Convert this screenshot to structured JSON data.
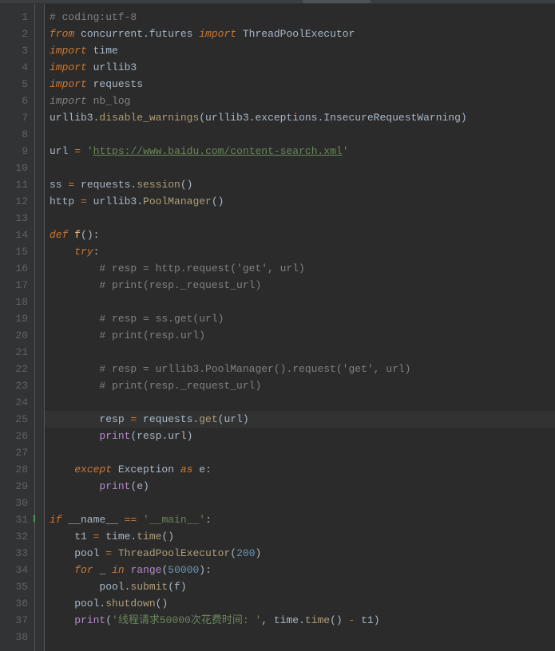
{
  "lines": {
    "l1_comment": "# coding:utf-8",
    "l2_from": "from",
    "l2_mod": " concurrent.futures ",
    "l2_imp": "import",
    "l2_name": " ThreadPoolExecutor",
    "l3_imp": "import",
    "l3_name": " time",
    "l4_imp": "import",
    "l4_name": " urllib3",
    "l5_imp": "import",
    "l5_name": " requests",
    "l6_imp": "import",
    "l6_name": " nb_log",
    "l7_a": "urllib3.",
    "l7_fn": "disable_warnings",
    "l7_b": "(urllib3.exceptions.InsecureRequestWarning)",
    "l9_a": "url ",
    "l9_eq": "=",
    "l9_b": " ",
    "l9_q1": "'",
    "l9_url": "https://www.baidu.com/content-search.xml",
    "l9_q2": "'",
    "l11_a": "ss ",
    "l11_eq": "=",
    "l11_b": " requests.",
    "l11_fn": "session",
    "l11_c": "()",
    "l12_a": "http ",
    "l12_eq": "=",
    "l12_b": " urllib3.",
    "l12_fn": "PoolManager",
    "l12_c": "()",
    "l14_def": "def ",
    "l14_fn": "f",
    "l14_b": "():",
    "l15_try": "try",
    "l15_c": ":",
    "l16": "        # resp = http.request('get', url)",
    "l17": "        # print(resp._request_url)",
    "l19": "        # resp = ss.get(url)",
    "l20": "        # print(resp.url)",
    "l22": "        # resp = urllib3.PoolManager().request('get', url)",
    "l23": "        # print(resp._request_url)",
    "l25_a": "        resp ",
    "l25_eq": "=",
    "l25_b": " requests.",
    "l25_fn": "get",
    "l25_c": "(url)",
    "l26_a": "        ",
    "l26_fn": "print",
    "l26_b": "(resp.url)",
    "l28_a": "    ",
    "l28_exc": "except ",
    "l28_b": "Exception ",
    "l28_as": "as ",
    "l28_c": "e:",
    "l29_a": "        ",
    "l29_fn": "print",
    "l29_b": "(e)",
    "l31_if": "if ",
    "l31_a": "__name__ ",
    "l31_eq": "==",
    "l31_b": " ",
    "l31_str": "'__main__'",
    "l31_c": ":",
    "l32_a": "    t1 ",
    "l32_eq": "=",
    "l32_b": " time.",
    "l32_fn": "time",
    "l32_c": "()",
    "l33_a": "    pool ",
    "l33_eq": "=",
    "l33_b": " ",
    "l33_fn": "ThreadPoolExecutor",
    "l33_c": "(",
    "l33_num": "200",
    "l33_d": ")",
    "l34_a": "    ",
    "l34_for": "for ",
    "l34_b": "_ ",
    "l34_in": "in ",
    "l34_fn": "range",
    "l34_c": "(",
    "l34_num": "50000",
    "l34_d": "):",
    "l35_a": "        pool.",
    "l35_fn": "submit",
    "l35_b": "(f)",
    "l36_a": "    pool.",
    "l36_fn": "shutdown",
    "l36_b": "()",
    "l37_a": "    ",
    "l37_fn": "print",
    "l37_b": "(",
    "l37_str": "'线程请求50000次花费时间: '",
    "l37_c": ", time.",
    "l37_fn2": "time",
    "l37_d": "() ",
    "l37_op": "-",
    "l37_e": " t1)"
  },
  "gutter": [
    "1",
    "2",
    "3",
    "4",
    "5",
    "6",
    "7",
    "8",
    "9",
    "10",
    "11",
    "12",
    "13",
    "14",
    "15",
    "16",
    "17",
    "18",
    "19",
    "20",
    "21",
    "22",
    "23",
    "24",
    "25",
    "26",
    "27",
    "28",
    "29",
    "30",
    "31",
    "32",
    "33",
    "34",
    "35",
    "36",
    "37",
    "38"
  ]
}
